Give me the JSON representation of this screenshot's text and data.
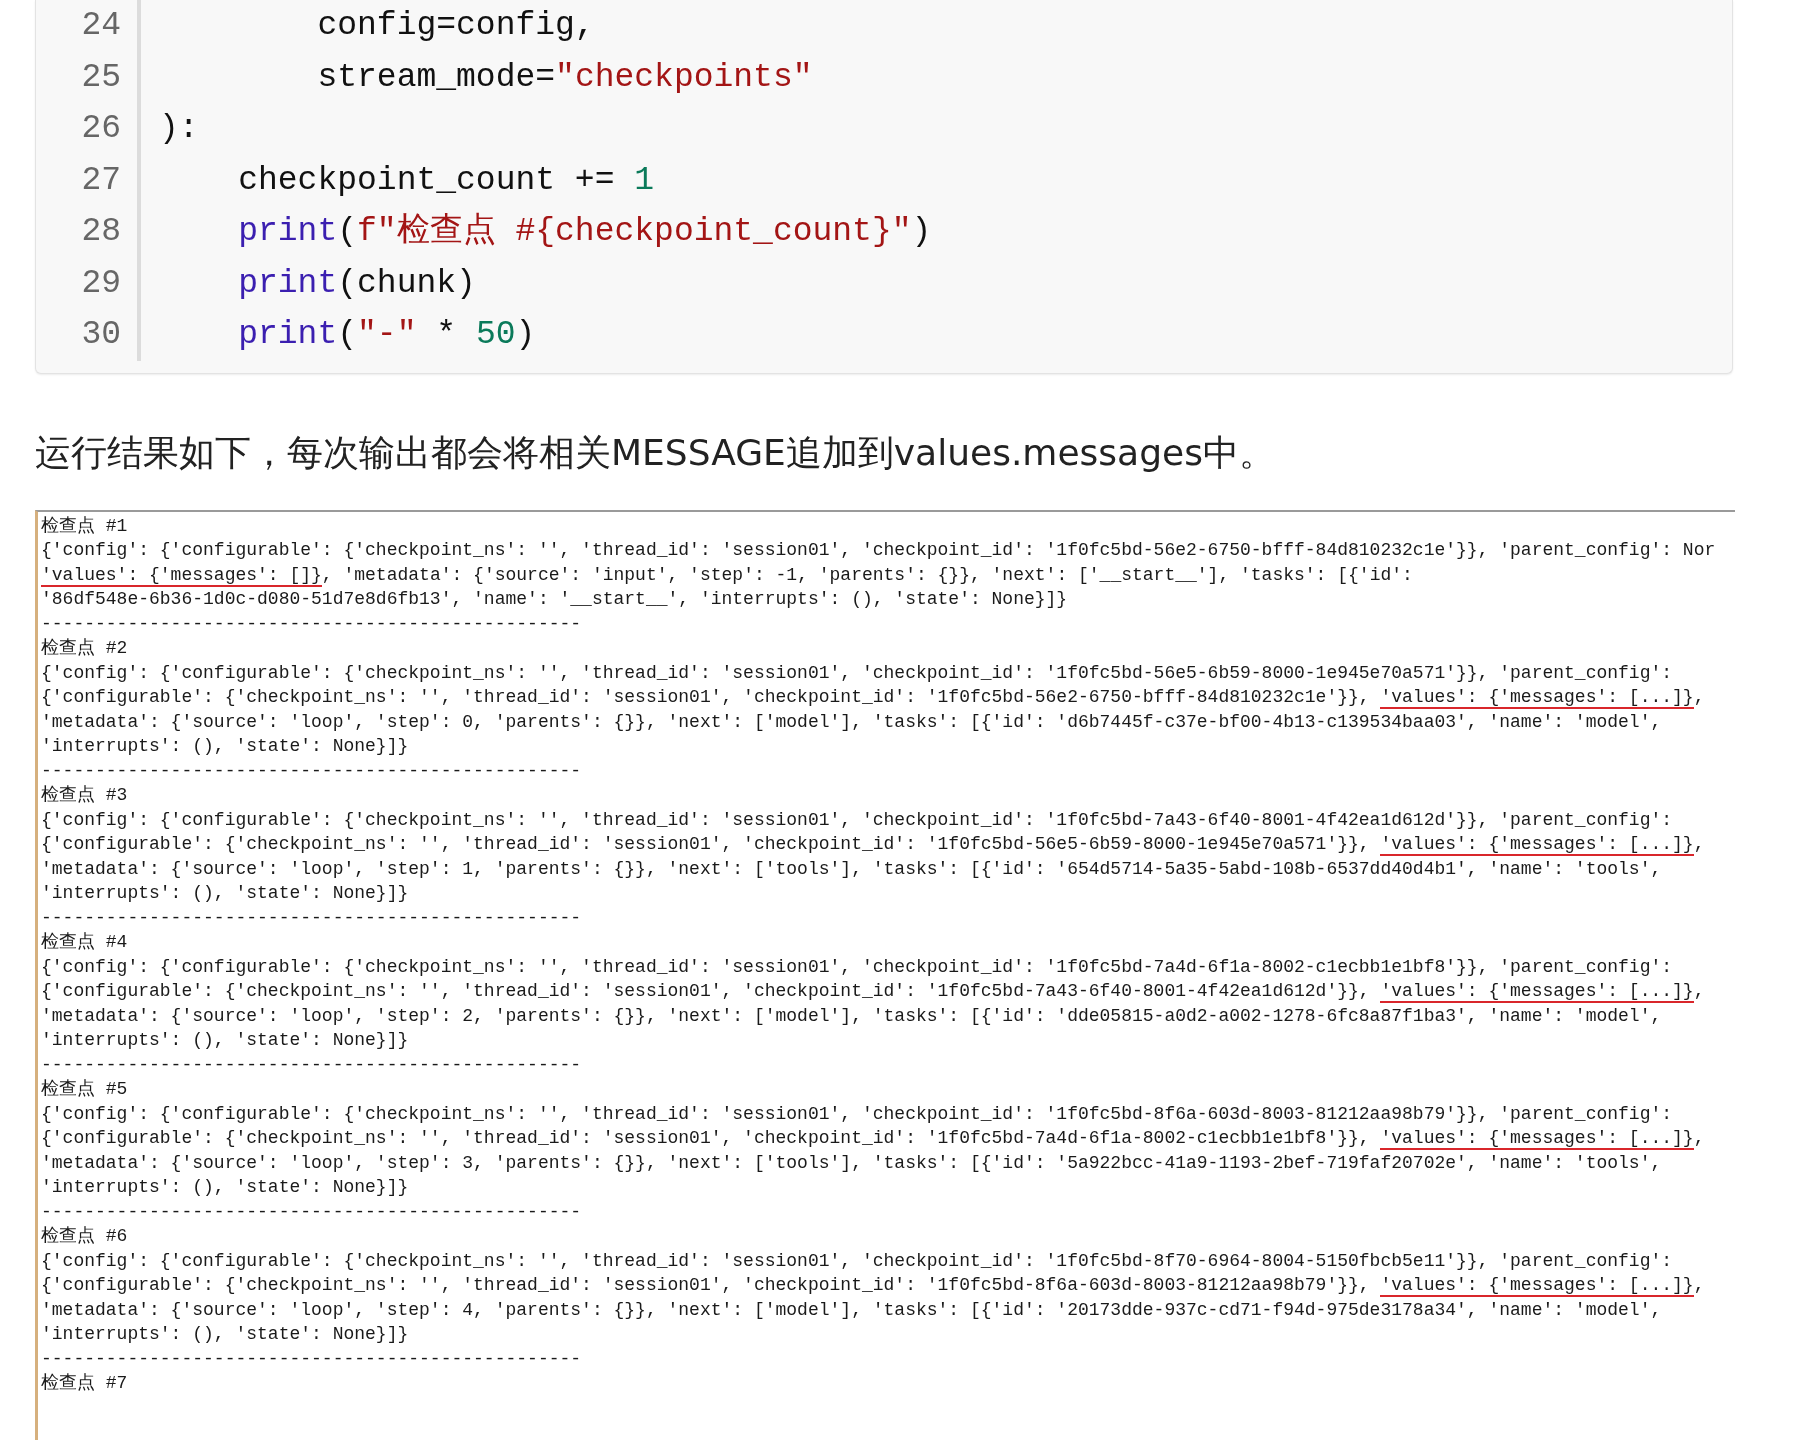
{
  "code_block": {
    "lines": [
      {
        "number": "24",
        "tokens": [
          {
            "text": "        config=config,",
            "kind": "plain"
          }
        ]
      },
      {
        "number": "25",
        "tokens": [
          {
            "text": "        stream_mode=",
            "kind": "plain"
          },
          {
            "text": "\"checkpoints\"",
            "kind": "string"
          }
        ]
      },
      {
        "number": "26",
        "tokens": [
          {
            "text": "):",
            "kind": "plain"
          }
        ]
      },
      {
        "number": "27",
        "tokens": [
          {
            "text": "    checkpoint_count += ",
            "kind": "plain"
          },
          {
            "text": "1",
            "kind": "number"
          }
        ]
      },
      {
        "number": "28",
        "tokens": [
          {
            "text": "    print",
            "kind": "builtin"
          },
          {
            "text": "(",
            "kind": "plain"
          },
          {
            "text": "f\"检查点 #{checkpoint_count}\"",
            "kind": "string"
          },
          {
            "text": ")",
            "kind": "plain"
          }
        ]
      },
      {
        "number": "29",
        "tokens": [
          {
            "text": "    print",
            "kind": "builtin"
          },
          {
            "text": "(chunk)",
            "kind": "plain"
          }
        ]
      },
      {
        "number": "30",
        "tokens": [
          {
            "text": "    print",
            "kind": "builtin"
          },
          {
            "text": "(",
            "kind": "plain"
          },
          {
            "text": "\"-\"",
            "kind": "string"
          },
          {
            "text": " * ",
            "kind": "plain"
          },
          {
            "text": "50",
            "kind": "number"
          },
          {
            "text": ")",
            "kind": "plain"
          }
        ]
      }
    ]
  },
  "paragraph": "运行结果如下，每次输出都会将相关MESSAGE追加到values.messages中。",
  "console_output": {
    "lines": [
      {
        "segments": [
          {
            "text": "检查点 #1",
            "underlined": false
          }
        ]
      },
      {
        "segments": [
          {
            "text": "{'config': {'configurable': {'checkpoint_ns': '', 'thread_id': 'session01', 'checkpoint_id': '1f0fc5bd-56e2-6750-bfff-84d810232c1e'}}, 'parent_config': Nor",
            "underlined": false
          }
        ]
      },
      {
        "segments": [
          {
            "text": "'values': {'messages': []}",
            "underlined": true
          },
          {
            "text": ", 'metadata': {'source': 'input', 'step': -1, 'parents': {}}, 'next': ['__start__'], 'tasks': [{'id':",
            "underlined": false
          }
        ]
      },
      {
        "segments": [
          {
            "text": "'86df548e-6b36-1d0c-d080-51d7e8d6fb13', 'name': '__start__', 'interrupts': (), 'state': None}]}",
            "underlined": false
          }
        ]
      },
      {
        "segments": [
          {
            "text": "--------------------------------------------------",
            "underlined": false
          }
        ]
      },
      {
        "segments": [
          {
            "text": "检查点 #2",
            "underlined": false
          }
        ]
      },
      {
        "segments": [
          {
            "text": "{'config': {'configurable': {'checkpoint_ns': '', 'thread_id': 'session01', 'checkpoint_id': '1f0fc5bd-56e5-6b59-8000-1e945e70a571'}}, 'parent_config':",
            "underlined": false
          }
        ]
      },
      {
        "segments": [
          {
            "text": "{'configurable': {'checkpoint_ns': '', 'thread_id': 'session01', 'checkpoint_id': '1f0fc5bd-56e2-6750-bfff-84d810232c1e'}}, ",
            "underlined": false
          },
          {
            "text": "'values': {'messages': [...]}",
            "underlined": true
          },
          {
            "text": ",",
            "underlined": false
          }
        ]
      },
      {
        "segments": [
          {
            "text": "'metadata': {'source': 'loop', 'step': 0, 'parents': {}}, 'next': ['model'], 'tasks': [{'id': 'd6b7445f-c37e-bf00-4b13-c139534baa03', 'name': 'model',",
            "underlined": false
          }
        ]
      },
      {
        "segments": [
          {
            "text": "'interrupts': (), 'state': None}]}",
            "underlined": false
          }
        ]
      },
      {
        "segments": [
          {
            "text": "--------------------------------------------------",
            "underlined": false
          }
        ]
      },
      {
        "segments": [
          {
            "text": "检查点 #3",
            "underlined": false
          }
        ]
      },
      {
        "segments": [
          {
            "text": "{'config': {'configurable': {'checkpoint_ns': '', 'thread_id': 'session01', 'checkpoint_id': '1f0fc5bd-7a43-6f40-8001-4f42ea1d612d'}}, 'parent_config':",
            "underlined": false
          }
        ]
      },
      {
        "segments": [
          {
            "text": "{'configurable': {'checkpoint_ns': '', 'thread_id': 'session01', 'checkpoint_id': '1f0fc5bd-56e5-6b59-8000-1e945e70a571'}}, ",
            "underlined": false
          },
          {
            "text": "'values': {'messages': [...]}",
            "underlined": true
          },
          {
            "text": ",",
            "underlined": false
          }
        ]
      },
      {
        "segments": [
          {
            "text": "'metadata': {'source': 'loop', 'step': 1, 'parents': {}}, 'next': ['tools'], 'tasks': [{'id': '654d5714-5a35-5abd-108b-6537dd40d4b1', 'name': 'tools',",
            "underlined": false
          }
        ]
      },
      {
        "segments": [
          {
            "text": "'interrupts': (), 'state': None}]}",
            "underlined": false
          }
        ]
      },
      {
        "segments": [
          {
            "text": "--------------------------------------------------",
            "underlined": false
          }
        ]
      },
      {
        "segments": [
          {
            "text": "检查点 #4",
            "underlined": false
          }
        ]
      },
      {
        "segments": [
          {
            "text": "{'config': {'configurable': {'checkpoint_ns': '', 'thread_id': 'session01', 'checkpoint_id': '1f0fc5bd-7a4d-6f1a-8002-c1ecbb1e1bf8'}}, 'parent_config':",
            "underlined": false
          }
        ]
      },
      {
        "segments": [
          {
            "text": "{'configurable': {'checkpoint_ns': '', 'thread_id': 'session01', 'checkpoint_id': '1f0fc5bd-7a43-6f40-8001-4f42ea1d612d'}}, ",
            "underlined": false
          },
          {
            "text": "'values': {'messages': [...]}",
            "underlined": true
          },
          {
            "text": ",",
            "underlined": false
          }
        ]
      },
      {
        "segments": [
          {
            "text": "'metadata': {'source': 'loop', 'step': 2, 'parents': {}}, 'next': ['model'], 'tasks': [{'id': 'dde05815-a0d2-a002-1278-6fc8a87f1ba3', 'name': 'model',",
            "underlined": false
          }
        ]
      },
      {
        "segments": [
          {
            "text": "'interrupts': (), 'state': None}]}",
            "underlined": false
          }
        ]
      },
      {
        "segments": [
          {
            "text": "--------------------------------------------------",
            "underlined": false
          }
        ]
      },
      {
        "segments": [
          {
            "text": "检查点 #5",
            "underlined": false
          }
        ]
      },
      {
        "segments": [
          {
            "text": "{'config': {'configurable': {'checkpoint_ns': '', 'thread_id': 'session01', 'checkpoint_id': '1f0fc5bd-8f6a-603d-8003-81212aa98b79'}}, 'parent_config':",
            "underlined": false
          }
        ]
      },
      {
        "segments": [
          {
            "text": "{'configurable': {'checkpoint_ns': '', 'thread_id': 'session01', 'checkpoint_id': '1f0fc5bd-7a4d-6f1a-8002-c1ecbb1e1bf8'}}, ",
            "underlined": false
          },
          {
            "text": "'values': {'messages': [...]}",
            "underlined": true
          },
          {
            "text": ",",
            "underlined": false
          }
        ]
      },
      {
        "segments": [
          {
            "text": "'metadata': {'source': 'loop', 'step': 3, 'parents': {}}, 'next': ['tools'], 'tasks': [{'id': '5a922bcc-41a9-1193-2bef-719faf20702e', 'name': 'tools',",
            "underlined": false
          }
        ]
      },
      {
        "segments": [
          {
            "text": "'interrupts': (), 'state': None}]}",
            "underlined": false
          }
        ]
      },
      {
        "segments": [
          {
            "text": "--------------------------------------------------",
            "underlined": false
          }
        ]
      },
      {
        "segments": [
          {
            "text": "检查点 #6",
            "underlined": false
          }
        ]
      },
      {
        "segments": [
          {
            "text": "{'config': {'configurable': {'checkpoint_ns': '', 'thread_id': 'session01', 'checkpoint_id': '1f0fc5bd-8f70-6964-8004-5150fbcb5e11'}}, 'parent_config':",
            "underlined": false
          }
        ]
      },
      {
        "segments": [
          {
            "text": "{'configurable': {'checkpoint_ns': '', 'thread_id': 'session01', 'checkpoint_id': '1f0fc5bd-8f6a-603d-8003-81212aa98b79'}}, ",
            "underlined": false
          },
          {
            "text": "'values': {'messages': [...]}",
            "underlined": true
          },
          {
            "text": ",",
            "underlined": false
          }
        ]
      },
      {
        "segments": [
          {
            "text": "'metadata': {'source': 'loop', 'step': 4, 'parents': {}}, 'next': ['model'], 'tasks': [{'id': '20173dde-937c-cd71-f94d-975de3178a34', 'name': 'model',",
            "underlined": false
          }
        ]
      },
      {
        "segments": [
          {
            "text": "'interrupts': (), 'state': None}]}",
            "underlined": false
          }
        ]
      },
      {
        "segments": [
          {
            "text": "--------------------------------------------------",
            "underlined": false
          }
        ]
      },
      {
        "segments": [
          {
            "text": "检查点 #7",
            "underlined": false
          }
        ]
      }
    ]
  }
}
